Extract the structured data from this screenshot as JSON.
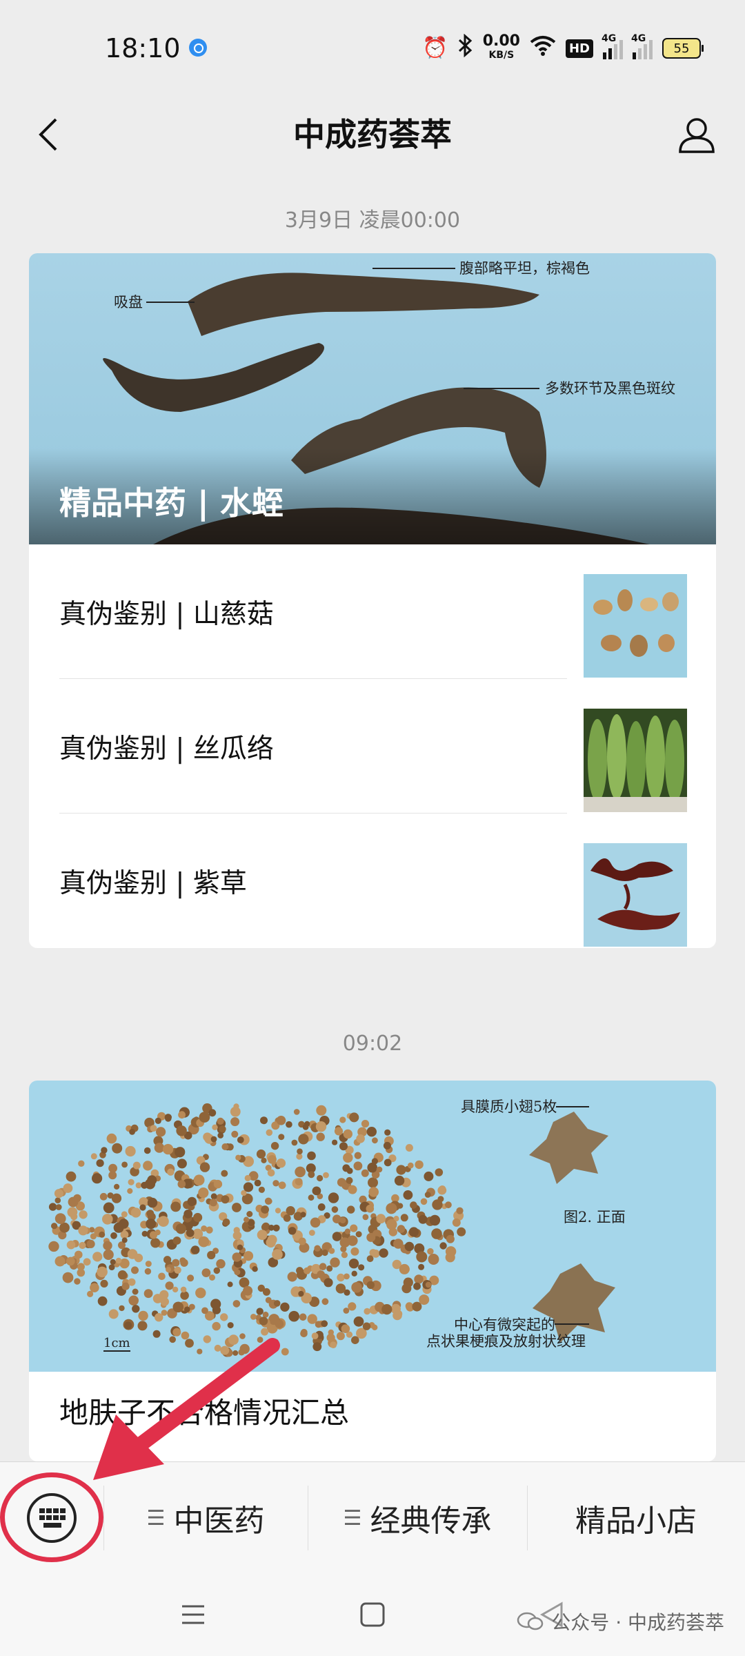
{
  "status_bar": {
    "time": "18:10",
    "net_speed_value": "0.00",
    "net_speed_unit": "KB/S",
    "hd_label": "HD",
    "signal1_label": "4G",
    "signal2_label": "4G",
    "battery": "55"
  },
  "header": {
    "title": "中成药荟萃"
  },
  "feed": {
    "group1": {
      "timestamp": "3月9日 凌晨00:00",
      "cover_title": "精品中药 | 水蛭",
      "cover_annotations": [
        "腹部略平坦，棕褐色",
        "吸盘",
        "多数环节及黑色斑纹"
      ],
      "items": [
        {
          "title": "真伪鉴别 | 山慈菇"
        },
        {
          "title": "真伪鉴别 | 丝瓜络"
        },
        {
          "title": "真伪鉴别 | 紫草"
        }
      ]
    },
    "group2": {
      "timestamp": "09:02",
      "cover_annotations": [
        "具膜质小翅5枚",
        "图2. 正面",
        "中心有微突起的",
        "点状果梗痕及放射状纹理",
        "1cm"
      ],
      "title": "地肤子不合格情况汇总"
    }
  },
  "menu": {
    "items": [
      {
        "label": "中医药"
      },
      {
        "label": "经典传承"
      },
      {
        "label": "精品小店"
      }
    ]
  },
  "watermark": "公众号 · 中成药荟萃",
  "colors": {
    "highlight": "#e0304a",
    "background": "#ededed",
    "card": "#ffffff"
  }
}
